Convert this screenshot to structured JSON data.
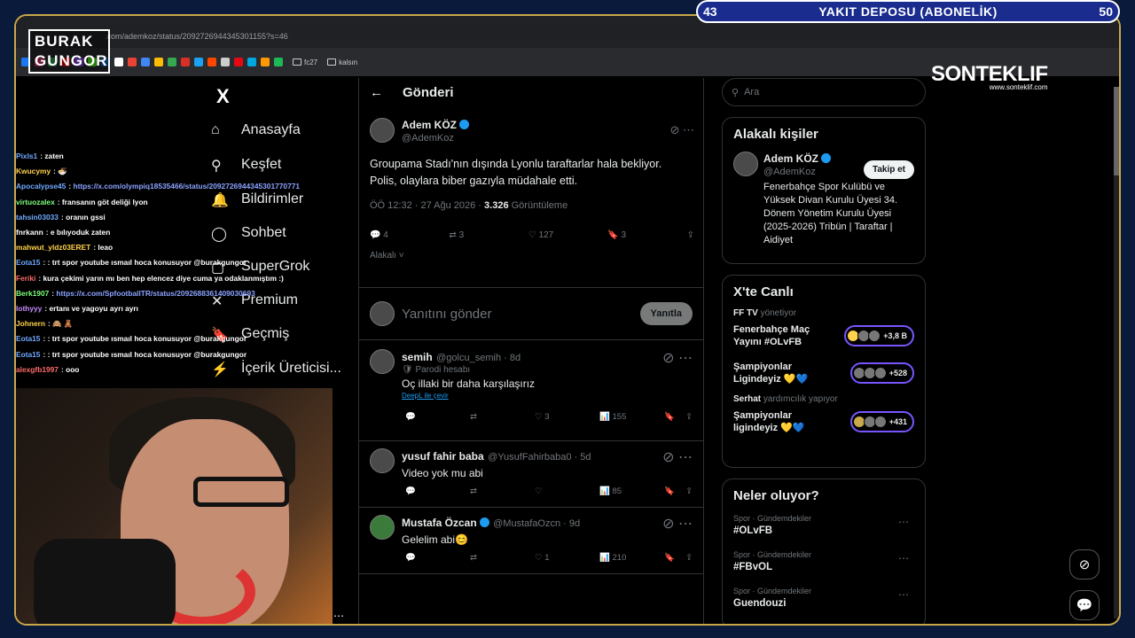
{
  "browser": {
    "url": ".com/ademkoz/status/2092726944345301155?s=46",
    "bookmark_folders": [
      "fc27",
      "kalsın"
    ]
  },
  "overlay": {
    "logo_line1": "BURAK",
    "logo_line2": "GUNGOR",
    "hud_left": "43",
    "hud_title": "YAKIT DEPOSU (ABONELİK)",
    "hud_right": "50",
    "sponsor": "SONTEKLIF",
    "sponsor_url": "www.sonteklif.com"
  },
  "nav": {
    "logo": "X",
    "items": [
      "Anasayfa",
      "Keşfet",
      "Bildirimler",
      "Sohbet",
      "SuperGrok",
      "Premium",
      "Geçmiş",
      "İçerik Üreticisi..."
    ]
  },
  "chat": [
    {
      "u": "Pixls1",
      "c": "#6fa8ff",
      "m": "zaten"
    },
    {
      "u": "Kwucymy",
      "c": "#ffd24a",
      "m": "🍜"
    },
    {
      "u": "Apocalypse45",
      "c": "#6fa8ff",
      "m": "https://x.com/olympiq18535466/status/2092726944345301770771",
      "link": true
    },
    {
      "u": "virtuozalex",
      "c": "#7dff7d",
      "m": "fransanın göt deliği lyon"
    },
    {
      "u": "tahsin03033",
      "c": "#6fa8ff",
      "m": "oranın gssi"
    },
    {
      "u": "fnrkann",
      "c": "#ffffff",
      "m": "e bılıyoduk zaten"
    },
    {
      "u": "mahwut_yldz03ERET",
      "c": "#ffd24a",
      "m": "leao"
    },
    {
      "u": "Eota15",
      "c": "#6fa8ff",
      "m": ": trt spor youtube ısmaıl hoca konusuyor @burakgungor"
    },
    {
      "u": "Feriki",
      "c": "#ff6a6a",
      "m": "kura çekimi yarın mı ben hep elencez diye cuma ya odaklanmıştım :)"
    },
    {
      "u": "Berk1907",
      "c": "#7dff7d",
      "m": "https://x.com/SpfootballTR/status/2092688361409030693",
      "link": true
    },
    {
      "u": "lothyyy",
      "c": "#c58cff",
      "m": "ertanı ve yagoyu ayrı ayrı"
    },
    {
      "u": "Johnern",
      "c": "#ffd24a",
      "m": "🙈 🧸"
    },
    {
      "u": "Eota15",
      "c": "#6fa8ff",
      "m": ": trt spor youtube ısmaıl hoca konusuyor @burakgungor"
    },
    {
      "u": "Eota15",
      "c": "#6fa8ff",
      "m": ": trt spor youtube ısmaıl hoca konusuyor @burakgungor"
    },
    {
      "u": "alexgfb1997",
      "c": "#ff6a6a",
      "m": "ooo"
    }
  ],
  "main": {
    "header": "Gönderi",
    "post": {
      "name": "Adem KÖZ",
      "handle": "@AdemKoz",
      "text1": "Groupama Stadı'nın dışında Lyonlu taraftarlar hala bekliyor.",
      "text2": "Polis, olaylara biber gazıyla müdahale etti.",
      "time": "ÖÖ 12:32 · 27 Ağu 2026 · ",
      "views": "3.326",
      "views_label": " Görüntüleme",
      "replies": "4",
      "reposts": "3",
      "likes": "127",
      "bookmarks": "3",
      "related": "Alakalı"
    },
    "reply_placeholder": "Yanıtını gönder",
    "reply_button": "Yanıtla",
    "comments": [
      {
        "name": "semih",
        "handle": "@golcu_semih · 8d",
        "sub": "Parodi hesabı",
        "text": "Oç illaki bir daha karşılaşırız",
        "translate": "DeepL ile çevir",
        "likes": "3",
        "views": "155"
      },
      {
        "name": "yusuf fahir baba",
        "handle": "@YusufFahirbaba0 · 5d",
        "text": "Video yok mu abi",
        "views": "85"
      },
      {
        "name": "Mustafa Özcan",
        "handle": "@MustafaOzcn · 9d",
        "text": "Gelelim abi😊",
        "likes": "1",
        "views": "210"
      }
    ]
  },
  "right": {
    "search_placeholder": "Ara",
    "related_title": "Alakalı kişiler",
    "person": {
      "name": "Adem KÖZ",
      "handle": "@AdemKoz",
      "follow": "Takip et",
      "bio": "Fenerbahçe Spor Kulübü ve Yüksek Divan Kurulu Üyesi 34. Dönem Yönetim Kurulu Üyesi (2025-2026) Tribün | Taraftar | Aidiyet"
    },
    "live_title": "X'te Canlı",
    "live": [
      {
        "host": "FF TV",
        "role": "yönetiyor",
        "title": "Fenerbahçe Maç Yayını #OLvFB",
        "count": "+3,8 B"
      },
      {
        "title": "Şampiyonlar Ligindeyiz 💛💙",
        "count": "+528"
      },
      {
        "host": "Serhat",
        "role": "yardımcılık yapıyor",
        "title": "Şampiyonlar ligindeyiz 💛💙",
        "count": "+431"
      }
    ],
    "trends_title": "Neler oluyor?",
    "trends": [
      {
        "cat": "Spor · Gündemdekiler",
        "tag": "#OLvFB"
      },
      {
        "cat": "Spor · Gündemdekiler",
        "tag": "#FBvOL"
      },
      {
        "cat": "Spor · Gündemdekiler",
        "tag": "Guendouzi"
      }
    ]
  }
}
